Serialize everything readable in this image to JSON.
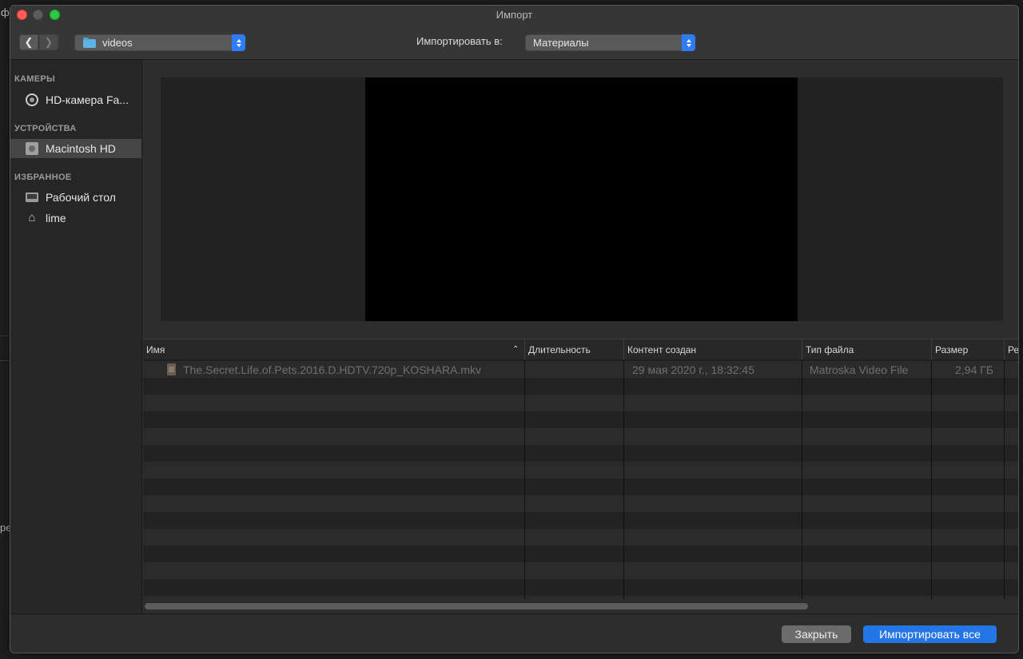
{
  "window": {
    "title": "Импорт"
  },
  "background": {
    "glyph_top": "ф",
    "glyph_mid": "ре"
  },
  "toolbar": {
    "folder": "videos",
    "import_to_label": "Импортировать в:",
    "destination": "Материалы"
  },
  "sidebar": {
    "sections": [
      {
        "header": "КАМЕРЫ",
        "items": [
          {
            "label": "HD-камера Fa...",
            "icon": "camera-icon"
          }
        ]
      },
      {
        "header": "УСТРОЙСТВА",
        "items": [
          {
            "label": "Macintosh HD",
            "icon": "disk-icon",
            "selected": true
          }
        ]
      },
      {
        "header": "ИЗБРАННОЕ",
        "items": [
          {
            "label": "Рабочий стол",
            "icon": "desktop-icon"
          },
          {
            "label": "lime",
            "icon": "home-icon"
          }
        ]
      }
    ]
  },
  "table": {
    "columns": [
      "Имя",
      "Длительность",
      "Контент создан",
      "Тип файла",
      "Размер",
      "Ре"
    ],
    "sort_column": "Имя",
    "rows": [
      {
        "name": "The.Secret.Life.of.Pets.2016.D.HDTV.720p_KOSHARA.mkv",
        "duration": "",
        "created": "29 мая 2020 г., 18:32:45",
        "type": "Matroska Video File",
        "size": "2,94 ГБ"
      }
    ]
  },
  "buttons": {
    "close": "Закрыть",
    "import_all": "Импортировать все"
  },
  "colors": {
    "accent": "#2475e6",
    "selected_row": "#464646"
  }
}
